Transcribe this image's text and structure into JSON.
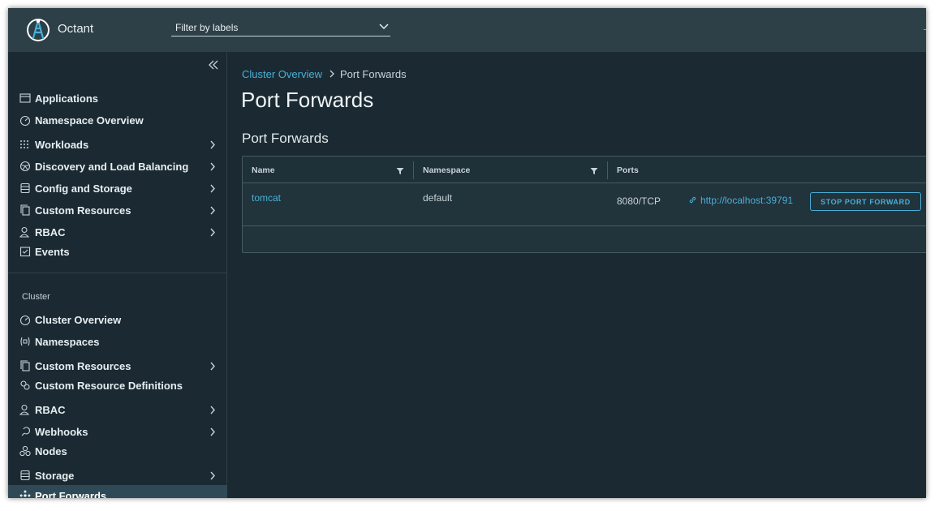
{
  "header": {
    "app_title": "Octant",
    "label_filter_placeholder": "Filter by labels"
  },
  "sidebar": {
    "namespace_items": [
      {
        "label": "Applications",
        "icon": "window-icon",
        "expandable": false
      },
      {
        "label": "Namespace Overview",
        "icon": "dashboard-icon",
        "expandable": false
      },
      {
        "label": "Workloads",
        "icon": "grid-icon",
        "expandable": true
      },
      {
        "label": "Discovery and Load Balancing",
        "icon": "network-globe-icon",
        "expandable": true
      },
      {
        "label": "Config and Storage",
        "icon": "storage-icon",
        "expandable": true
      },
      {
        "label": "Custom Resources",
        "icon": "copy-icon",
        "expandable": true
      },
      {
        "label": "RBAC",
        "icon": "user-icon",
        "expandable": true
      },
      {
        "label": "Events",
        "icon": "event-icon",
        "expandable": false
      }
    ],
    "cluster_heading": "Cluster",
    "cluster_items": [
      {
        "label": "Cluster Overview",
        "icon": "dashboard-icon",
        "expandable": false
      },
      {
        "label": "Namespaces",
        "icon": "namespace-icon",
        "expandable": false
      },
      {
        "label": "Custom Resources",
        "icon": "copy-icon",
        "expandable": true
      },
      {
        "label": "Custom Resource Definitions",
        "icon": "crd-icon",
        "expandable": false
      },
      {
        "label": "RBAC",
        "icon": "user-icon",
        "expandable": true
      },
      {
        "label": "Webhooks",
        "icon": "webhook-icon",
        "expandable": true
      },
      {
        "label": "Nodes",
        "icon": "nodes-icon",
        "expandable": false
      },
      {
        "label": "Storage",
        "icon": "storage-icon",
        "expandable": true
      },
      {
        "label": "Port Forwards",
        "icon": "port-forward-icon",
        "expandable": false,
        "active": true
      }
    ]
  },
  "breadcrumb": {
    "parent": "Cluster Overview",
    "current": "Port Forwards"
  },
  "page_title": "Port Forwards",
  "section_title": "Port Forwards",
  "table": {
    "columns": [
      "Name",
      "Namespace",
      "Ports"
    ],
    "rows": [
      {
        "name": "tomcat",
        "namespace": "default",
        "port": "8080/TCP",
        "url": "http://localhost:39791",
        "action": "STOP PORT FORWARD"
      }
    ]
  },
  "colors": {
    "accent": "#49afd9",
    "header_bg": "#2d3f47",
    "app_bg": "#1b2a32",
    "active_nav_bg": "#2f4a56"
  }
}
